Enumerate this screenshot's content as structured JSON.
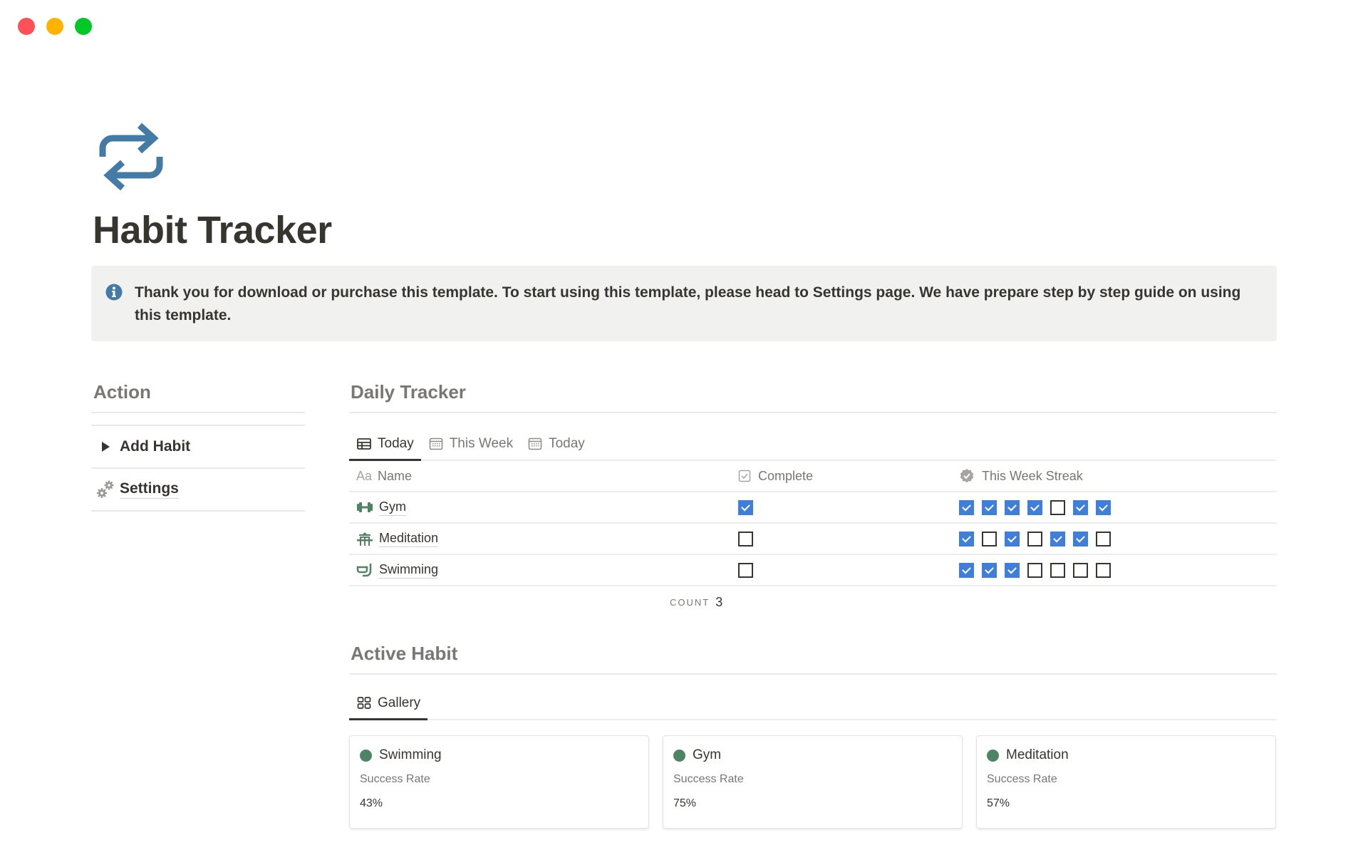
{
  "window": {
    "controls": [
      "close",
      "minimize",
      "zoom"
    ]
  },
  "page": {
    "icon": "repeat-arrows-icon",
    "title": "Habit Tracker",
    "accent_color": "#447aa6"
  },
  "callout": {
    "icon": "info-icon",
    "text": "Thank you for download or purchase this template. To start using this template, please head to Settings page. We have prepare step by step guide on using this template."
  },
  "sidebar": {
    "heading": "Action",
    "items": [
      {
        "label": "Add Habit",
        "icon": "toggle-triangle-icon"
      },
      {
        "label": "Settings",
        "icon": "gears-icon"
      }
    ]
  },
  "daily_tracker": {
    "heading": "Daily Tracker",
    "tabs": [
      {
        "label": "Today",
        "icon": "table-icon",
        "active": true
      },
      {
        "label": "This Week",
        "icon": "calendar-icon",
        "active": false
      },
      {
        "label": "Today",
        "icon": "calendar-icon",
        "active": false
      }
    ],
    "columns": [
      {
        "label": "Name",
        "icon_text": "Aa"
      },
      {
        "label": "Complete",
        "icon": "checkbox-icon"
      },
      {
        "label": "This Week Streak",
        "icon": "verified-badge-icon"
      }
    ],
    "rows": [
      {
        "name": "Gym",
        "icon": "dumbbell-icon",
        "complete": true,
        "streak": [
          true,
          true,
          true,
          true,
          false,
          true,
          true
        ]
      },
      {
        "name": "Meditation",
        "icon": "pavilion-icon",
        "complete": false,
        "streak": [
          true,
          false,
          true,
          false,
          true,
          true,
          false
        ]
      },
      {
        "name": "Swimming",
        "icon": "snorkel-icon",
        "complete": false,
        "streak": [
          true,
          true,
          true,
          false,
          false,
          false,
          false
        ]
      }
    ],
    "count_label": "COUNT",
    "count_value": "3",
    "checkbox_color": "#3f7fdb"
  },
  "active_habit": {
    "heading": "Active Habit",
    "tabs": [
      {
        "label": "Gallery",
        "icon": "gallery-icon",
        "active": true
      }
    ],
    "cards": [
      {
        "title": "Swimming",
        "label": "Success Rate",
        "value": "43%"
      },
      {
        "title": "Gym",
        "label": "Success Rate",
        "value": "75%"
      },
      {
        "title": "Meditation",
        "label": "Success Rate",
        "value": "57%"
      }
    ],
    "dot_color": "#4e8363"
  }
}
